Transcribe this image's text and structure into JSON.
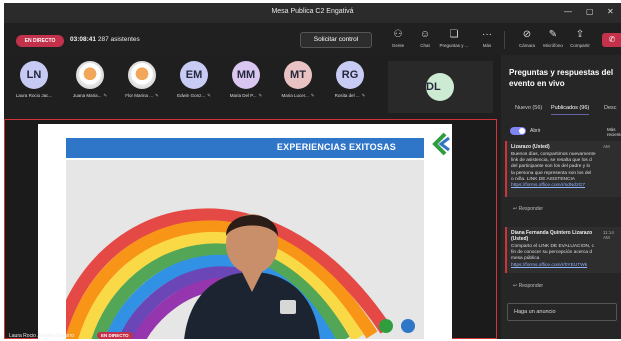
{
  "window": {
    "title": "Mesa Publica C2 Engativá"
  },
  "toolbar": {
    "live_label": "EN DIRECTO",
    "elapsed": "03:08:41",
    "attendees": "287 asistentes",
    "request_control": "Solicitar control",
    "tools": [
      {
        "icon": "people-icon",
        "label": "Gente"
      },
      {
        "icon": "chat-icon",
        "label": "Chat"
      },
      {
        "icon": "qa-icon",
        "label": "Preguntas y ..."
      },
      {
        "icon": "more-icon",
        "label": "Más"
      },
      {
        "icon": "camera-off-icon",
        "label": "Cámara"
      },
      {
        "icon": "mic-off-icon",
        "label": "Micrófono"
      },
      {
        "icon": "share-icon",
        "label": "Compartir"
      }
    ]
  },
  "participants": [
    {
      "initials": "LN",
      "name": "Laura Rocio Jac...",
      "color": "#c7cbf3",
      "photo": false
    },
    {
      "initials": "",
      "name": "Juana Maria...",
      "color": "",
      "photo": true
    },
    {
      "initials": "",
      "name": "Flor Marina ...",
      "color": "",
      "photo": true
    },
    {
      "initials": "EM",
      "name": "Edwin Gonz...",
      "color": "#c8ccf4",
      "photo": false
    },
    {
      "initials": "MM",
      "name": "Maria Del P...",
      "color": "#d9c6f1",
      "photo": false
    },
    {
      "initials": "MT",
      "name": "Maria Lucer...",
      "color": "#e9c3c4",
      "photo": false
    },
    {
      "initials": "RG",
      "name": "Rosita del ...",
      "color": "#c8ccf4",
      "photo": false
    }
  ],
  "spotlight_tile": {
    "initials": "DL",
    "color": "#cdebd3"
  },
  "stage": {
    "slide_title": "EXPERIENCIAS EXITOSAS",
    "presenter_name": "Laura Rocio Jacome Navarro",
    "presenter_badge": "EN DIRECTO"
  },
  "panel": {
    "title": "Preguntas y respuestas del evento en vivo",
    "tabs": [
      "Nuevo (56)",
      "Publicados (96)",
      "Desc"
    ],
    "toggle_label": "Abrir",
    "more_label": "Más recientes",
    "cards": [
      {
        "author": "Lizarazo (Usted)",
        "time": "AM",
        "text": "Buenos días, compartimos nuevamente\nlink de asistencia, se resalta que los d\ndel participante son los del padre y lo\nla persona que representa son los del\no niña. LINK DE ASISTENCIA",
        "link": "https://forms.office.com/r/sdNd2G7",
        "reply": "Responder"
      },
      {
        "author": "Diana Fernanda Quintero Lizarazo (Usted)",
        "time": "11:14 AM",
        "text": "Comparto el LINK DE EVALUACION, c\nfin de conocer su percepción acerca d\nmesa pública",
        "link": "https://forms.office.com/r/0YEUTWk",
        "reply": "Responder"
      }
    ],
    "announcement_placeholder": "Haga un anuncio"
  }
}
